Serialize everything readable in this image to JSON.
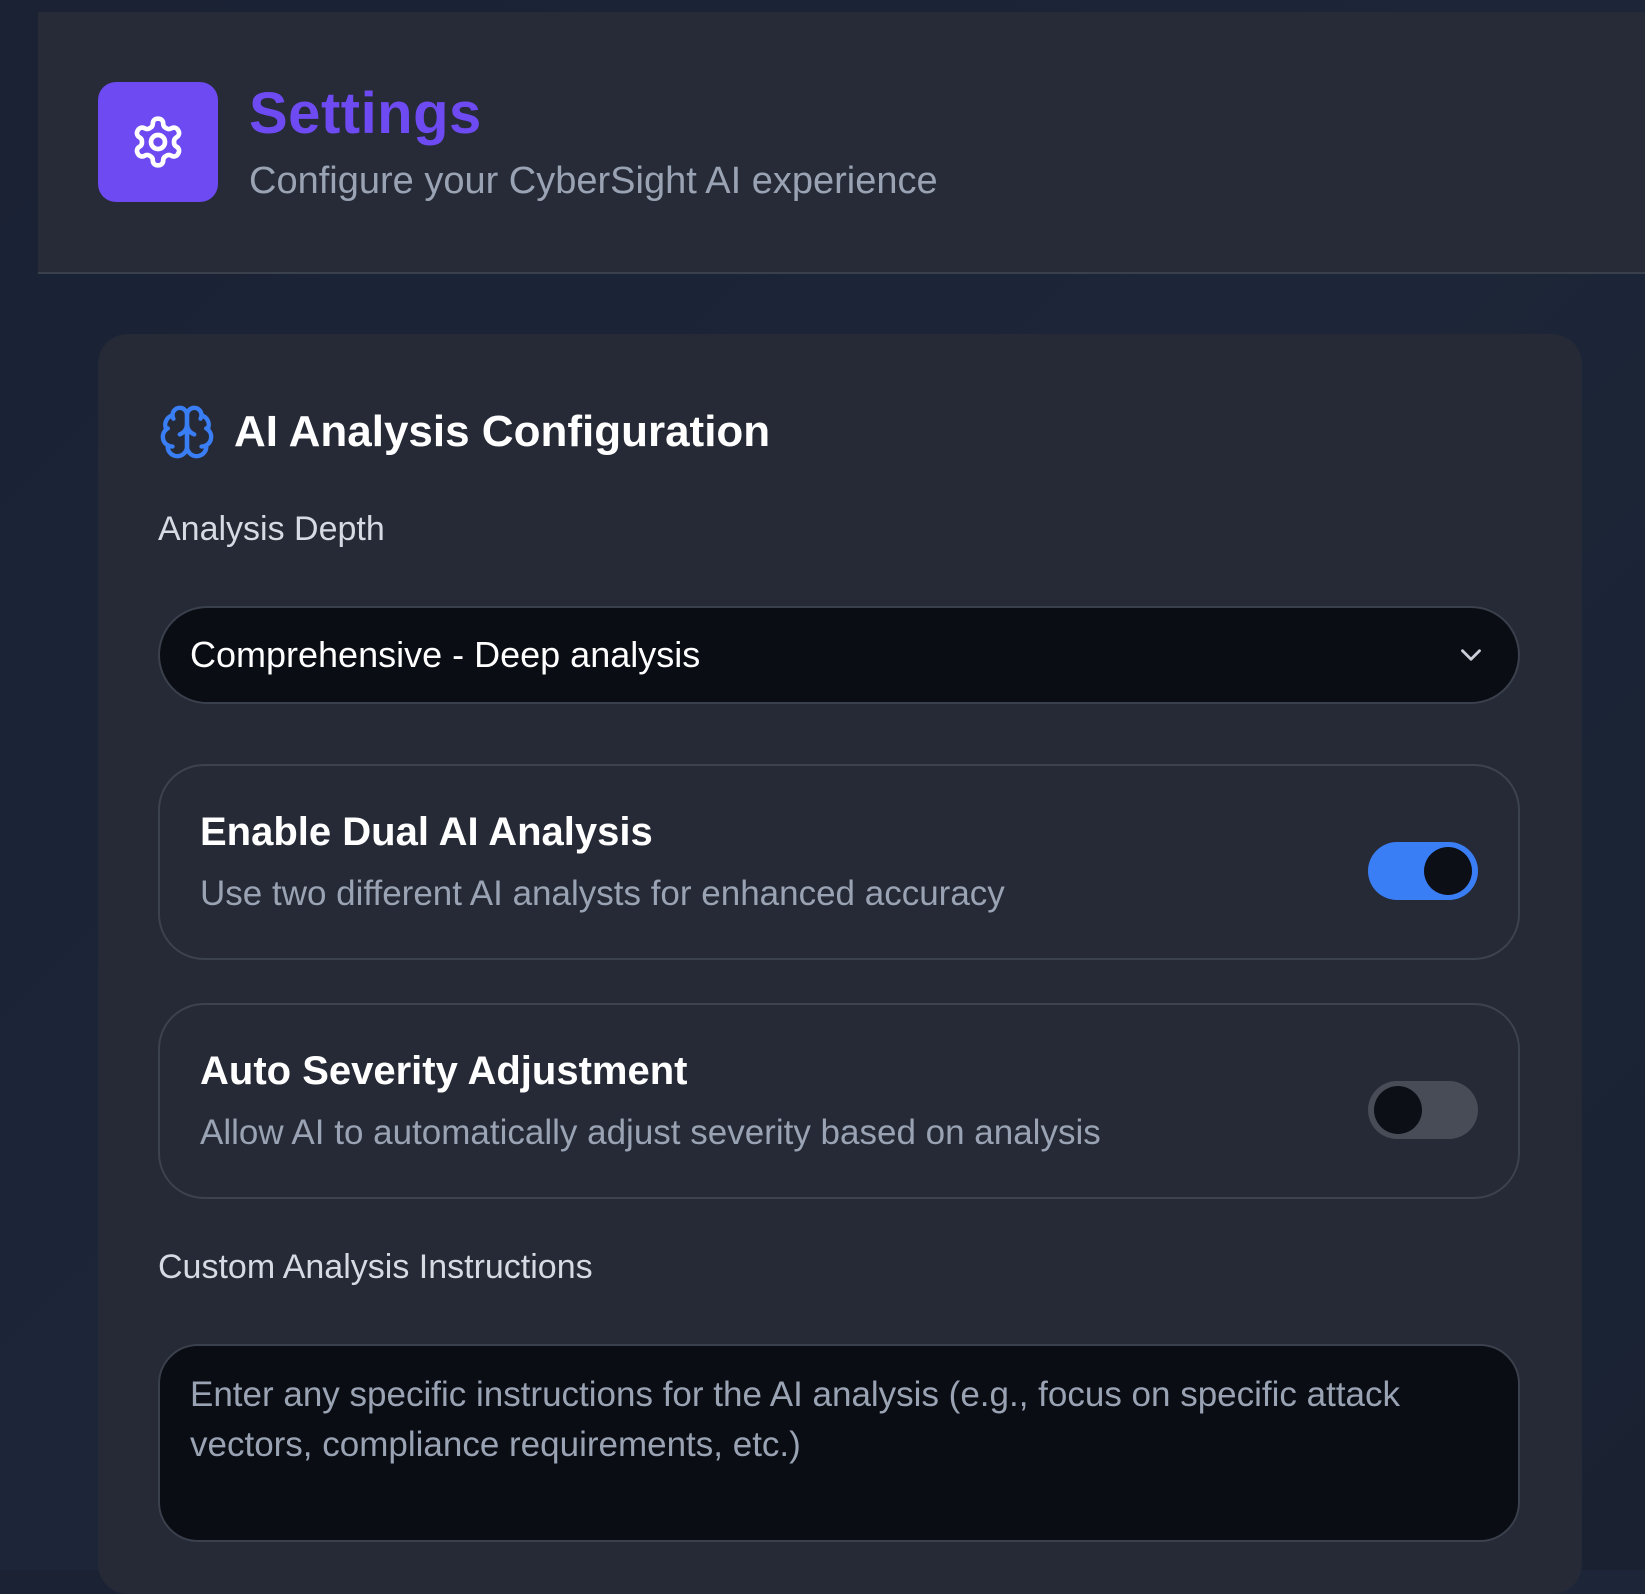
{
  "header": {
    "title": "Settings",
    "subtitle": "Configure your CyberSight AI experience",
    "icon": "gear-icon"
  },
  "ai_config": {
    "title": "AI Analysis Configuration",
    "icon": "brain-icon",
    "analysis_depth": {
      "label": "Analysis Depth",
      "selected": "Comprehensive - Deep analysis"
    },
    "dual_ai": {
      "title": "Enable Dual AI Analysis",
      "description": "Use two different AI analysts for enhanced accuracy",
      "enabled": true
    },
    "auto_severity": {
      "title": "Auto Severity Adjustment",
      "description": "Allow AI to automatically adjust severity based on analysis",
      "enabled": false
    },
    "custom_instructions": {
      "label": "Custom Analysis Instructions",
      "placeholder": "Enter any specific instructions for the AI analysis (e.g., focus on specific attack vectors, compliance requirements, etc.)"
    }
  },
  "colors": {
    "accent": "#6e4af2",
    "toggle_on": "#3a7ef5",
    "brain_icon": "#3a7ef5"
  }
}
